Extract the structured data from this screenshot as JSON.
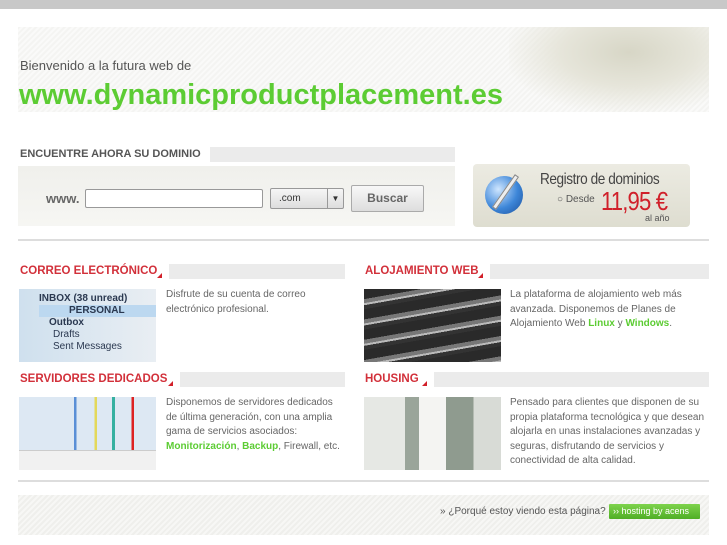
{
  "header": {
    "welcome": "Bienvenido a la futura web de",
    "domain": "www.dynamicproductplacement.es"
  },
  "search": {
    "title": "ENCUENTRE AHORA SU DOMINIO",
    "prefix": "www.",
    "input_value": "",
    "tld_selected": ".com",
    "button": "Buscar"
  },
  "promo": {
    "title": "Registro de dominios",
    "from": "Desde",
    "price": "11,95 €",
    "period": "al año"
  },
  "sections": [
    {
      "title": "CORREO ELECTRÓNICO",
      "text": "Disfrute de su cuenta de correo electrónico profesional."
    },
    {
      "title": "ALOJAMIENTO WEB",
      "text": "La plataforma de alojamiento web más avanzada. Disponemos de Planes de Alojamiento Web ",
      "link1": "Linux",
      "mid": " y ",
      "link2": "Windows",
      "end": "."
    },
    {
      "title": "SERVIDORES DEDICADOS",
      "text": "Disponemos de servidores dedicados de última generación, con una amplia gama de servicios asociados: ",
      "link1": "Monitorización",
      "mid": ", ",
      "link2": "Backup",
      "end": ", Firewall, etc."
    },
    {
      "title": "HOUSING",
      "text": "Pensado para clientes que disponen de su propia plataforma tecnológica y que desean alojarla en unas instalaciones avanzadas y seguras, disfrutando de servicios y conectividad de alta calidad."
    }
  ],
  "email_image": {
    "lines": [
      "INBOX (38 unread)",
      "PERSONAL",
      "Outbox",
      "Drafts",
      "Sent Messages"
    ]
  },
  "footer": {
    "why": "» ¿Porqué estoy viendo esta página?",
    "badge": "›› hosting by acens"
  },
  "colors": {
    "green": "#5ccc33",
    "red": "#d2303a"
  }
}
